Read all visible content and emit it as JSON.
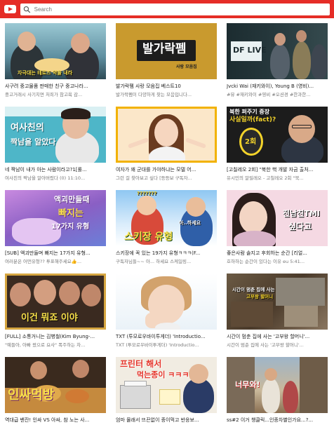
{
  "app": {
    "logo_icon": "youtube-play-icon",
    "accent": "#e52d27"
  },
  "search": {
    "placeholder": "Search",
    "icon": "search-icon"
  },
  "videos": [
    {
      "title": "사구려 중고물품 판매한 친구 중고나라...",
      "subtitle": "중고거래시 사기치면 처죄가 참고욕 감...",
      "caption": "자극대는 테로즈 약을 내라"
    },
    {
      "title": "발가락펨 사랑 모음집 베스트10",
      "subtitle": "발가락펨이 다양하게 찾는 모음입니다...",
      "caption": "발가락펨",
      "caption2": "사랑 모음집"
    },
    {
      "title": "Jvcki Wai (재키와이), Young B (영비)...",
      "subtitle": "#뮤 #재키와이 #영비 #오션경 #한과한...",
      "caption": "DF LIVE"
    },
    {
      "title": "네 짝남이 내가 아는 사람이라고?1[롤...",
      "subtitle": "여사친의 짝남을 알아버렸다 (0) 11:10...",
      "caption": "여사친의",
      "caption2": "짝남을 알았다"
    },
    {
      "title": "여자가 왜 군대를 가야하냐는 모델 어...",
      "subtitle": "그런 걸 찾아보고 싶다 [등등보 구독자...",
      "caption": ""
    },
    {
      "title": "[고칠레오 2회] \"북한 핵 개발 자금 출처...",
      "subtitle": "유시민의 알릴레오 - 고칠레오 2회 \"북...",
      "caption": "북한 퍼주기 중장",
      "caption2": "사실일까(fact)?",
      "caption3": "2회"
    },
    {
      "title": "[SUB] 액괴만들며 빠지는 17가지 유형...",
      "subtitle": "여러분은 어떤유형?? 투표해주세요👍...",
      "caption": "액괴만들때",
      "caption2": "빠지는",
      "caption3": "17가지 유형"
    },
    {
      "title": "스키장에 꼭 있는 19가지 유형ㅋㅋㅋ(F...",
      "subtitle": "구독자님들~~ 아... 하세요 스케일링...",
      "caption": "스키장 유형",
      "caption2": "???????",
      "caption3": "아..하세요"
    },
    {
      "title": "좋은사람 솔지고 후회하는 순간 [리얼...",
      "subtitle": "호하하는 순간이 있다는 이유 eu 5:41...",
      "caption": "전남친TMI",
      "caption2": "싶다고"
    },
    {
      "title": "[FULL] 소통거니는 김병철(Kim Byung-...",
      "subtitle": "\"예들아, 아빠 왔으로 요사\" 폭주하는 차...",
      "caption": "이건 뭐죠 이야"
    },
    {
      "title": "TXT (투모로우바이투게더) 'Introductio...",
      "subtitle": "TXT (투모로우바이투게더) 'Introductio...",
      "caption": ""
    },
    {
      "title": "시간이 멈춘 집에 사는 '고부왕 할머니'...",
      "subtitle": "시간이 멈춘 집에 사는 '고부왕 할머니'...",
      "caption": "시간이 멈춘 집에 사는",
      "caption2": "고부왕 할머니"
    },
    {
      "title": "역대급 밴잔! 인싸 VS 아싸, 참 노는 사...",
      "subtitle": "",
      "caption": "인싸먹방"
    },
    {
      "title": "엄마 몰래서 뜨끈없이 종이먹고 반응보...",
      "subtitle": "",
      "caption": "프린터 해서",
      "caption2": "먹는종이 ㅋㅋㅋ"
    },
    {
      "title": "ss#2 이거 챙클릭...인종차별인가요...?...",
      "subtitle": "",
      "caption": "너무와!"
    }
  ]
}
